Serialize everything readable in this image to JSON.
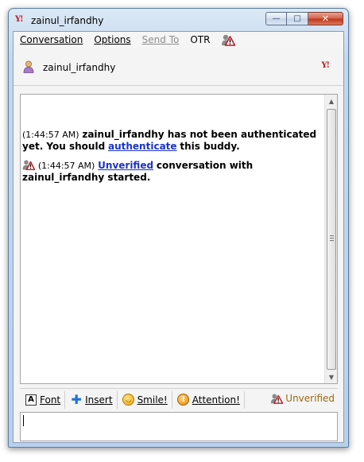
{
  "window": {
    "title": "zainul_irfandhy",
    "app_icon_text": "Y!",
    "minimize_glyph": "—",
    "maximize_glyph": "□",
    "close_glyph": "✕"
  },
  "menu": {
    "conversation": "Conversation",
    "options": "Options",
    "send_to": "Send To",
    "otr": "OTR"
  },
  "buddy": {
    "name": "zainul_irfandhy",
    "protocol_icon_text": "Y!"
  },
  "messages": [
    {
      "timestamp": "(1:44:57 AM)",
      "text_before": "zainul_irfandhy has not been authenticated yet.  You should",
      "link": "authenticate",
      "text_after": "this buddy."
    },
    {
      "timestamp": "(1:44:57 AM)",
      "link": "Unverified",
      "text_after": "conversation with zainul_irfandhy started."
    }
  ],
  "toolbar": {
    "font": "Font",
    "insert": "Insert",
    "smile": "Smile!",
    "attention": "Attention!",
    "otr_status": "Unverified"
  },
  "input": {
    "value": ""
  },
  "colors": {
    "link": "#1a33cc",
    "otr_status": "#9a6a0e",
    "yahoo_red": "#c0171f"
  },
  "icons": {
    "otr_unverified": "otr-unverified-icon",
    "font": "font-icon",
    "insert": "plus-icon",
    "smile": "smiley-icon",
    "attention": "attention-icon",
    "buddy": "buddy-avatar-icon"
  }
}
